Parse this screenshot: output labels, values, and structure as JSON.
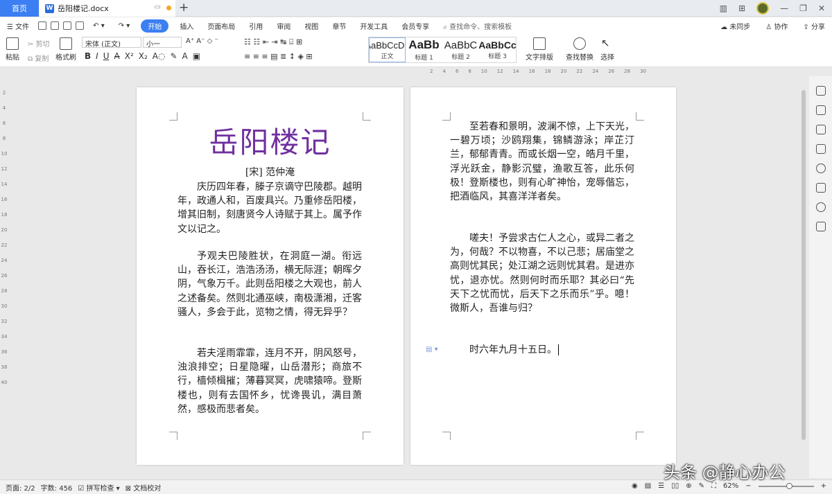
{
  "tabs": {
    "home": "首页",
    "document": "岳阳楼记.docx"
  },
  "menu": {
    "file": "文件",
    "items": [
      "开始",
      "插入",
      "页面布局",
      "引用",
      "审阅",
      "视图",
      "章节",
      "开发工具",
      "会员专享"
    ],
    "search_placeholder": "查找命令、搜索模板",
    "sync": "未同步",
    "collab": "协作",
    "share": "分享"
  },
  "ribbon": {
    "paste": "粘贴",
    "cut": "剪切",
    "copy": "复制",
    "format_painter": "格式刷",
    "font_name": "宋体 (正文)",
    "font_size": "小一",
    "styles": [
      {
        "sample": "AaBbCcDd",
        "label": "正文"
      },
      {
        "sample": "AaBb",
        "label": "标题 1"
      },
      {
        "sample": "AaBbC",
        "label": "标题 2"
      },
      {
        "sample": "AaBbCc",
        "label": "标题 3"
      }
    ],
    "text_layout": "文字排版",
    "find_replace": "查找替换",
    "select": "选择"
  },
  "accent_color": "#3b7ff2",
  "title_color": "#7030a0",
  "document": {
    "title": "岳阳楼记",
    "author": "[宋] 范仲淹",
    "page1_paragraphs": [
      "庆历四年春，滕子京谪守巴陵郡。越明年，政通人和，百废具兴。乃重修岳阳楼，增其旧制，刻唐贤今人诗赋于其上。属予作文以记之。",
      "予观夫巴陵胜状，在洞庭一湖。衔远山，吞长江，浩浩汤汤，横无际涯；朝晖夕阴，气象万千。此则岳阳楼之大观也，前人之述备矣。然则北通巫峡，南极潇湘，迁客骚人，多会于此，览物之情，得无异乎？",
      "若夫淫雨霏霏，连月不开，阴风怒号，浊浪排空；日星隐曜，山岳潜形；商旅不行，樯倾楫摧；薄暮冥冥，虎啸猿啼。登斯楼也，则有去国怀乡，忧谗畏讥，满目萧然，感极而悲者矣。"
    ],
    "page2_paragraphs": [
      "至若春和景明，波澜不惊，上下天光，一碧万顷；沙鸥翔集，锦鳞游泳；岸芷汀兰，郁郁青青。而或长烟一空，皓月千里，浮光跃金，静影沉璧，渔歌互答，此乐何极！登斯楼也，则有心旷神怡，宠辱偕忘，把酒临风，其喜洋洋者矣。",
      "嗟夫！予尝求古仁人之心，或异二者之为，何哉？不以物喜，不以己悲；居庙堂之高则忧其民；处江湖之远则忧其君。是进亦忧，退亦忧。然则何时而乐耶？其必曰“先天下之忧而忧，后天下之乐而乐”乎。噫！微斯人，吾谁与归？",
      "时六年九月十五日。"
    ]
  },
  "status": {
    "page": "页面: 2/2",
    "words": "字数: 456",
    "spell_check": "拼写检查",
    "doc_proof": "文档校对",
    "zoom": "62%"
  },
  "watermark": "头条 @静心办公"
}
